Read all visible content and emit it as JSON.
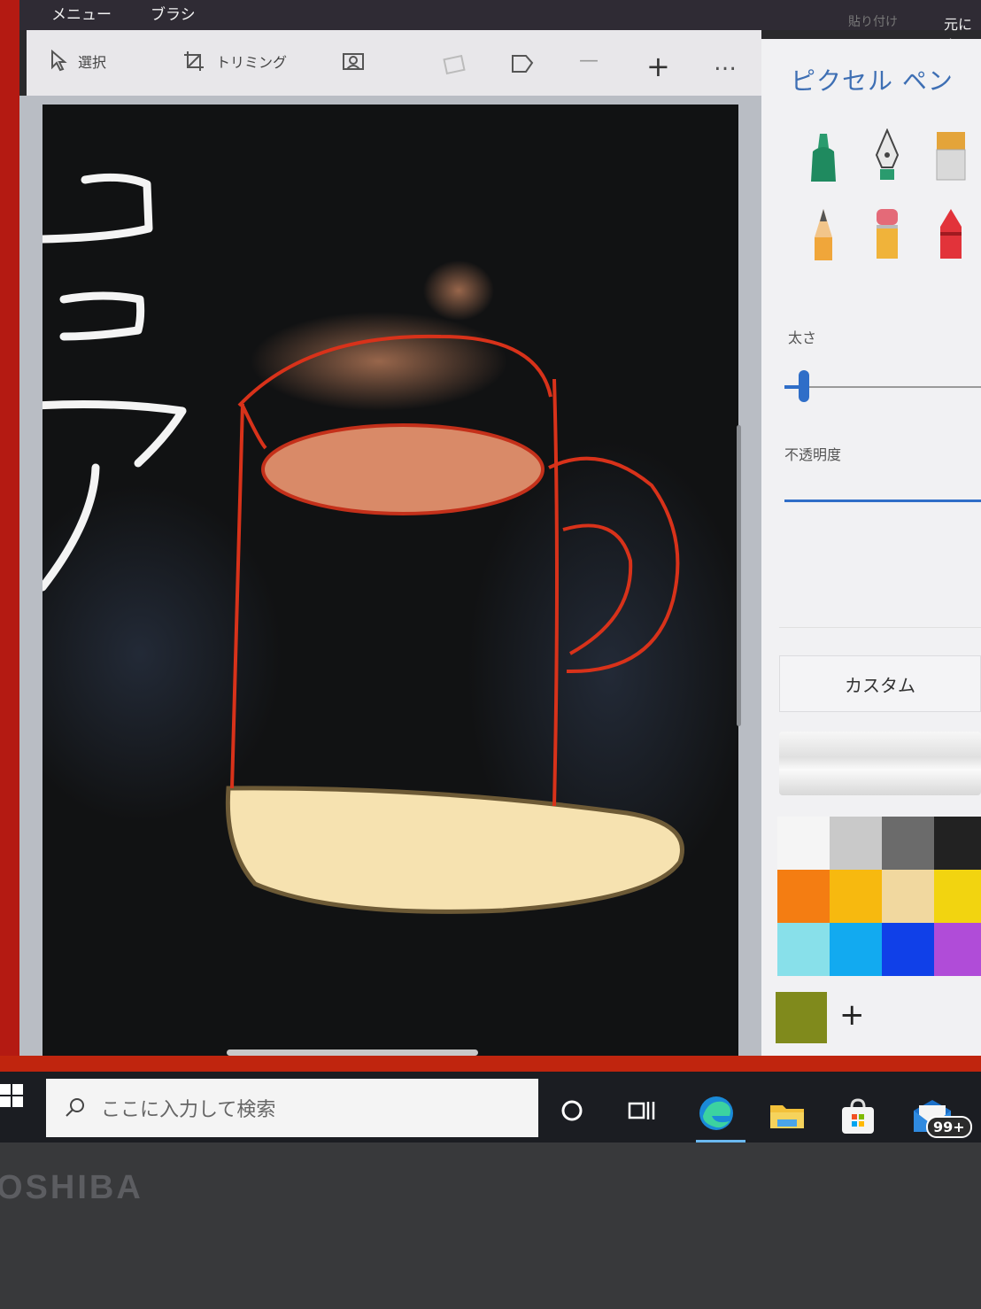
{
  "menu": {
    "menu_label": "メニュー",
    "brush_label": "ブラシ",
    "paste_label": "貼り付け",
    "undo_label": "元に戻"
  },
  "toolbar": {
    "select_label": "選択",
    "crop_label": "トリミング",
    "more_label": "…",
    "minus_label": "—",
    "plus_label": "+"
  },
  "panel": {
    "title": "ピクセル ペン",
    "thickness_label": "太さ",
    "opacity_label": "不透明度",
    "custom_label": "カスタム",
    "add_color_label": "+",
    "brushes": [
      "marker-icon",
      "calligraphy-pen-icon",
      "oil-brush-icon",
      "pencil-icon",
      "eraser-icon",
      "crayon-icon"
    ],
    "thickness_value": 0.1,
    "opacity_value": 1.0,
    "palette": [
      [
        "#f5f5f5",
        "#c9c9c9",
        "#6b6b6b",
        "#222222"
      ],
      [
        "#f47d12",
        "#f7b90f",
        "#f1d89f",
        "#f2d410"
      ],
      [
        "#88e0ea",
        "#12aaf0",
        "#1040e8",
        "#b04cd8"
      ]
    ],
    "selected_color": "#808a1c"
  },
  "drawing": {
    "text": "ココア",
    "cup_outline": "#d8321a",
    "cocoa_fill": "#d98a68",
    "saucer_fill": "#f6e2b0"
  },
  "taskbar": {
    "search_placeholder": "ここに入力して検索",
    "mail_badge": "99+"
  },
  "bezel": {
    "brand": "OSHIBA"
  }
}
